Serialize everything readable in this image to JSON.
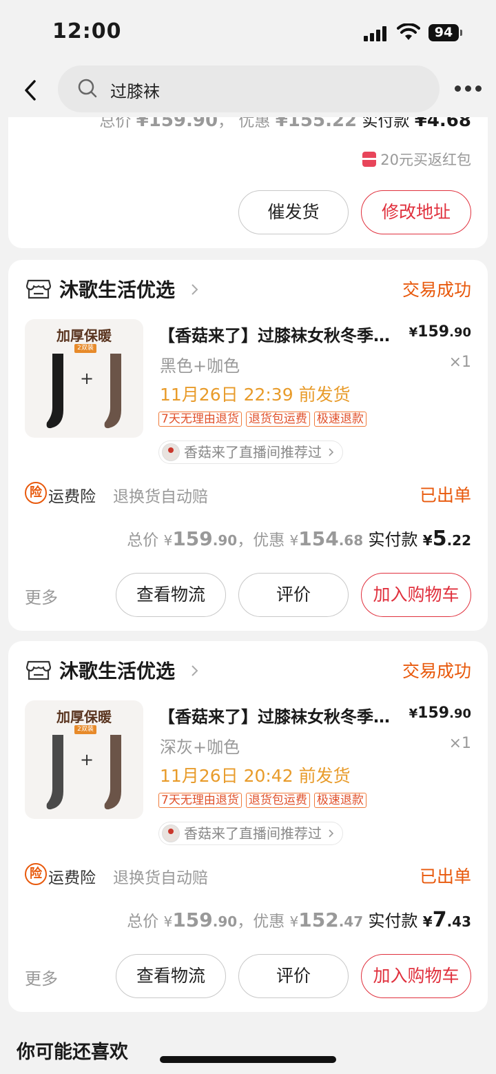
{
  "status_bar": {
    "time": "12:00",
    "battery": "94"
  },
  "search": {
    "query": "过膝袜"
  },
  "first_order": {
    "summary_total_label": "总价",
    "summary_total": "¥159.90",
    "summary_discount_label": "优惠",
    "summary_discount": "¥155.22",
    "summary_pay_label": "实付款",
    "summary_pay": "¥4.68",
    "redpacket": "20元买返红包",
    "btn_urge": "催发货",
    "btn_address": "修改地址"
  },
  "orders": [
    {
      "shop": "沐歌生活优选",
      "status": "交易成功",
      "thumb_title": "加厚保暖",
      "thumb_badge": "2双装",
      "thumb_plus": "+",
      "title": "【香菇来了】过膝袜女秋冬季…",
      "price_yen": "¥",
      "price_int": "159",
      "price_dec": ".90",
      "variant": "黑色+咖色",
      "qty": "×1",
      "ship": "11月26日 22:39 前发货",
      "tags": [
        "7天无理由退货",
        "退货包运费",
        "极速退款"
      ],
      "live": "香菇来了直播间推荐过",
      "ins_icon": "险",
      "ins_name": "运费险",
      "ins_desc": "退换货自动赔",
      "ins_status": "已出单",
      "total_label": "总价",
      "total_int": "159",
      "total_dec": ".90",
      "discount_label": "，优惠",
      "discount_int": "154",
      "discount_dec": ".68",
      "pay_label": "实付款",
      "pay_int": "5",
      "pay_dec": ".22",
      "yen": "¥",
      "more": "更多",
      "btn_logistics": "查看物流",
      "btn_review": "评价",
      "btn_cart": "加入购物车",
      "sock_colors": [
        "#1c1c1c",
        "#6b5448"
      ]
    },
    {
      "shop": "沐歌生活优选",
      "status": "交易成功",
      "thumb_title": "加厚保暖",
      "thumb_badge": "2双装",
      "thumb_plus": "+",
      "title": "【香菇来了】过膝袜女秋冬季…",
      "price_yen": "¥",
      "price_int": "159",
      "price_dec": ".90",
      "variant": "深灰+咖色",
      "qty": "×1",
      "ship": "11月26日 20:42 前发货",
      "tags": [
        "7天无理由退货",
        "退货包运费",
        "极速退款"
      ],
      "live": "香菇来了直播间推荐过",
      "ins_icon": "险",
      "ins_name": "运费险",
      "ins_desc": "退换货自动赔",
      "ins_status": "已出单",
      "total_label": "总价",
      "total_int": "159",
      "total_dec": ".90",
      "discount_label": "，优惠",
      "discount_int": "152",
      "discount_dec": ".47",
      "pay_label": "实付款",
      "pay_int": "7",
      "pay_dec": ".43",
      "yen": "¥",
      "more": "更多",
      "btn_logistics": "查看物流",
      "btn_review": "评价",
      "btn_cart": "加入购物车",
      "sock_colors": [
        "#4a4a4a",
        "#6b5448"
      ]
    }
  ],
  "recommend_title": "你可能还喜欢",
  "colors": {
    "accent_red": "#e0303d",
    "accent_orange": "#e8590c",
    "ship_orange": "#e89b2a"
  }
}
